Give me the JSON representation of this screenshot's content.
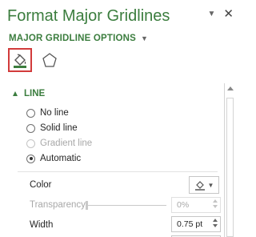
{
  "pane": {
    "title": "Format Major Gridlines",
    "options_label": "MAJOR GRIDLINE OPTIONS",
    "tabs": [
      {
        "icon": "fill-line-icon",
        "selected": true
      },
      {
        "icon": "effects-icon",
        "selected": false
      }
    ]
  },
  "line_section": {
    "header": "LINE",
    "options": [
      {
        "label": "No line",
        "checked": false,
        "enabled": true
      },
      {
        "label": "Solid line",
        "checked": false,
        "enabled": true
      },
      {
        "label": "Gradient line",
        "checked": false,
        "enabled": false
      },
      {
        "label": "Automatic",
        "checked": true,
        "enabled": true
      }
    ],
    "color_label": "Color",
    "transparency_label": "Transparency",
    "transparency_value": "0%",
    "width_label": "Width",
    "width_value": "0.75 pt"
  },
  "colors": {
    "accent": "#3b7d3e",
    "selected_tab_border": "#d23b3b"
  }
}
